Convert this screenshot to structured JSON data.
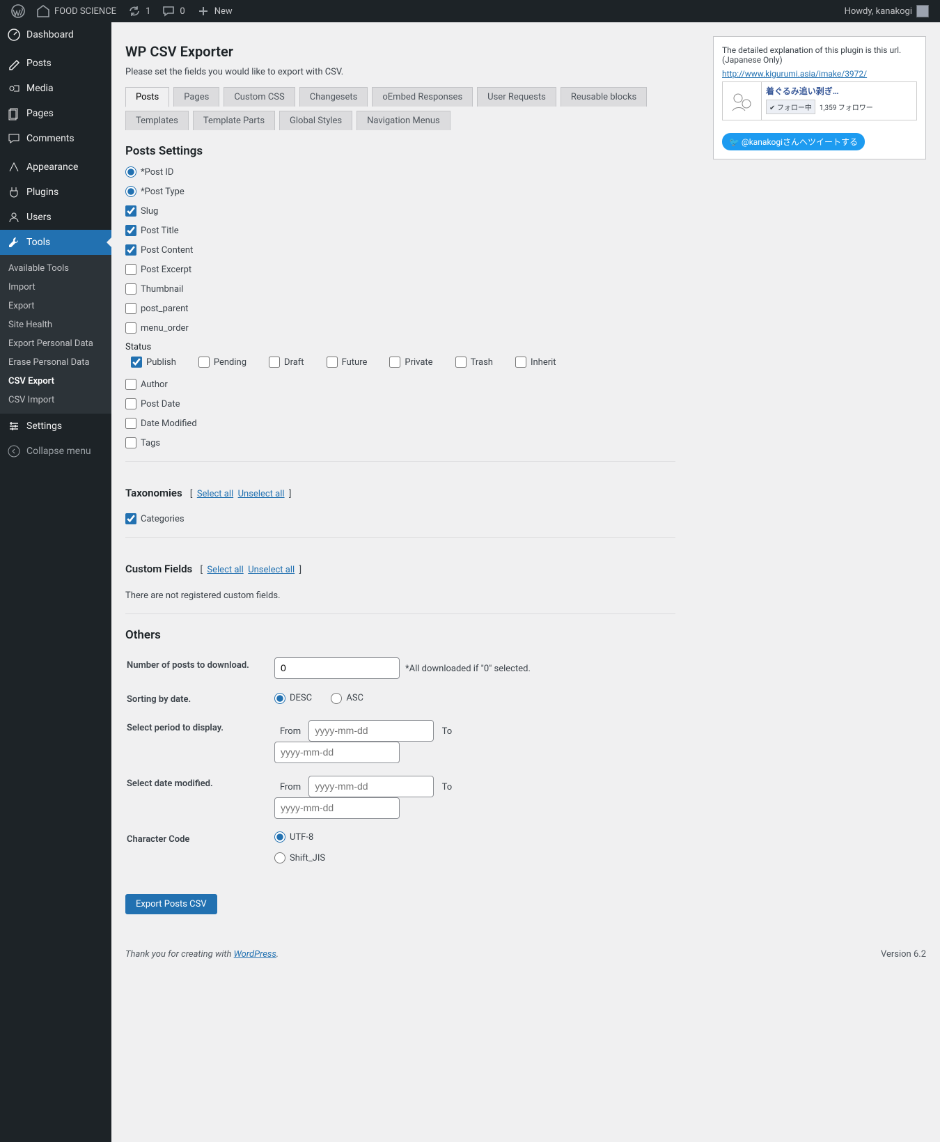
{
  "adminbar": {
    "site_name": "FOOD SCIENCE",
    "updates": "1",
    "comments": "0",
    "new": "New",
    "howdy": "Howdy, kanakogi"
  },
  "menu": {
    "dashboard": "Dashboard",
    "posts": "Posts",
    "media": "Media",
    "pages": "Pages",
    "comments": "Comments",
    "appearance": "Appearance",
    "plugins": "Plugins",
    "users": "Users",
    "tools": "Tools",
    "settings": "Settings",
    "collapse": "Collapse menu"
  },
  "submenu": {
    "available_tools": "Available Tools",
    "import": "Import",
    "export": "Export",
    "site_health": "Site Health",
    "export_personal": "Export Personal Data",
    "erase_personal": "Erase Personal Data",
    "csv_export": "CSV Export",
    "csv_import": "CSV Import"
  },
  "page": {
    "title": "WP CSV Exporter",
    "intro": "Please set the fields you would like to export with CSV."
  },
  "tabs": {
    "posts": "Posts",
    "pages": "Pages",
    "custom_css": "Custom CSS",
    "changesets": "Changesets",
    "oembed": "oEmbed Responses",
    "user_requests": "User Requests",
    "reusable": "Reusable blocks",
    "templates": "Templates",
    "template_parts": "Template Parts",
    "global_styles": "Global Styles",
    "nav_menus": "Navigation Menus"
  },
  "postbox": {
    "text1": "The detailed explanation of this plugin is this url.(Japanese Only)",
    "url": "http://www.kigurumi.asia/imake/3972/",
    "fb_title": "着ぐるみ追い剥ぎ…",
    "fb_follow": "フォロー中",
    "fb_count": "1,359 フォロワー",
    "twitter": "@kanakogiさんへツイートする"
  },
  "sections": {
    "posts_settings": "Posts Settings",
    "status": "Status",
    "taxonomies": "Taxonomies",
    "custom_fields": "Custom Fields",
    "others": "Others",
    "select_all": "Select all",
    "unselect_all": "Unselect all",
    "no_custom_fields": "There are not registered custom fields."
  },
  "fields": {
    "post_id": "*Post ID",
    "post_type": "*Post Type",
    "slug": "Slug",
    "post_title": "Post Title",
    "post_content": "Post Content",
    "post_excerpt": "Post Excerpt",
    "thumbnail": "Thumbnail",
    "post_parent": "post_parent",
    "menu_order": "menu_order",
    "author": "Author",
    "post_date": "Post Date",
    "date_modified": "Date Modified",
    "tags": "Tags"
  },
  "status": {
    "publish": "Publish",
    "pending": "Pending",
    "draft": "Draft",
    "future": "Future",
    "private": "Private",
    "trash": "Trash",
    "inherit": "Inherit"
  },
  "tax": {
    "categories": "Categories"
  },
  "others": {
    "num_label": "Number of posts to download.",
    "num_value": "0",
    "num_hint": "*All downloaded if \"0\" selected.",
    "sort_label": "Sorting by date.",
    "desc": "DESC",
    "asc": "ASC",
    "period_label": "Select period to display.",
    "modified_label": "Select date modified.",
    "from": "From",
    "to": "To",
    "date_ph": "yyyy-mm-dd",
    "charcode_label": "Character Code",
    "utf8": "UTF-8",
    "sjis": "Shift_JIS"
  },
  "buttons": {
    "export": "Export Posts CSV"
  },
  "footer": {
    "thanks": "Thank you for creating with ",
    "wp": "WordPress",
    "version": "Version 6.2"
  }
}
